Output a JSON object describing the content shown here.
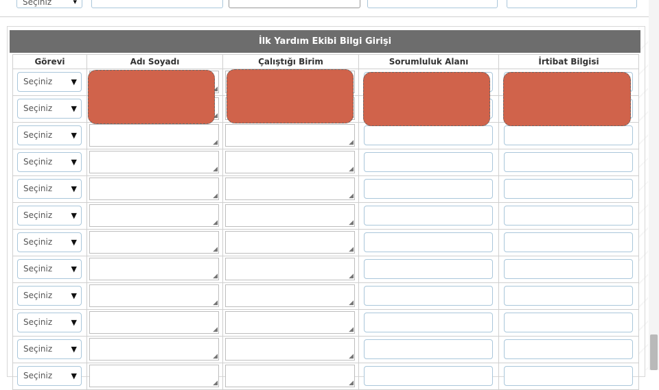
{
  "form": {
    "title": "İlk Yardım Ekibi Bilgi Girişi",
    "columns": [
      "Görevi",
      "Adı Soyadı",
      "Çalıştığı Birim",
      "Sorumluluk Alanı",
      "İrtibat Bilgisi"
    ],
    "select_placeholder": "Seçiniz",
    "row_count": 12
  },
  "top_strip": {
    "select_value": "Seçiniz",
    "close_glyph": "x"
  },
  "colors": {
    "header_bg": "#6d6d6d",
    "input_border": "#a9c6da",
    "redaction": "#d0634b"
  }
}
